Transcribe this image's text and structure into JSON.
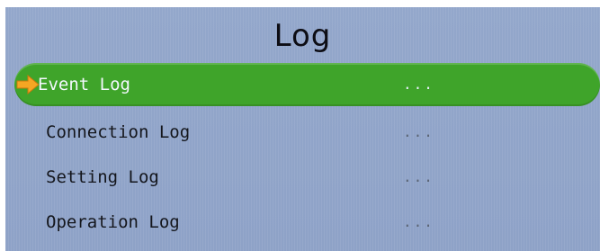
{
  "title": "Log",
  "menu": {
    "items": [
      {
        "label": "Event Log",
        "value": "...",
        "selected": true
      },
      {
        "label": "Connection Log",
        "value": "...",
        "selected": false
      },
      {
        "label": "Setting Log",
        "value": "...",
        "selected": false
      },
      {
        "label": "Operation Log",
        "value": "...",
        "selected": false
      }
    ]
  },
  "colors": {
    "background": "#8fa3c8",
    "selection": "#3fa42a",
    "arrow": "#f5a623"
  },
  "icons": {
    "selection_indicator": "arrow-right-icon"
  }
}
